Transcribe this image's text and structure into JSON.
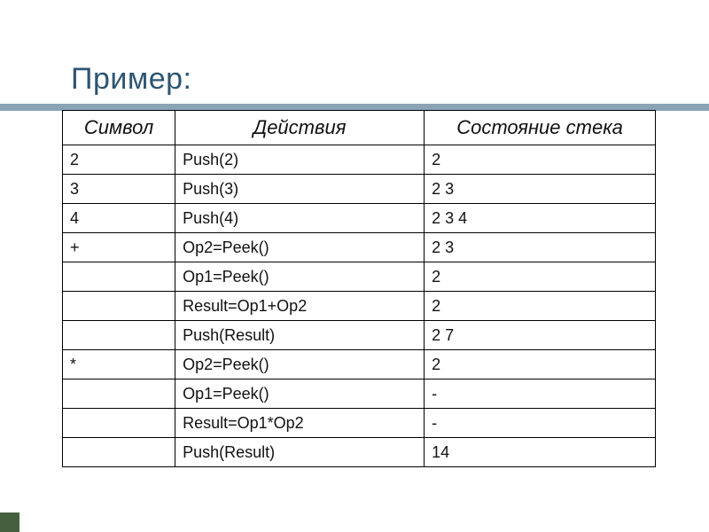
{
  "title": "Пример:",
  "table": {
    "headers": [
      "Символ",
      "Действия",
      "Состояние стека"
    ],
    "rows": [
      [
        "2",
        "Push(2)",
        "2"
      ],
      [
        "3",
        "Push(3)",
        "2 3"
      ],
      [
        "4",
        "Push(4)",
        "2 3 4"
      ],
      [
        "+",
        "Op2=Peek()",
        "2 3"
      ],
      [
        "",
        "Op1=Peek()",
        "2"
      ],
      [
        "",
        "Result=Op1+Op2",
        "2"
      ],
      [
        "",
        "Push(Result)",
        "2 7"
      ],
      [
        "*",
        "Op2=Peek()",
        "2"
      ],
      [
        "",
        "Op1=Peek()",
        "-"
      ],
      [
        "",
        "Result=Op1*Op2",
        "-"
      ],
      [
        "",
        "Push(Result)",
        "14"
      ]
    ]
  }
}
